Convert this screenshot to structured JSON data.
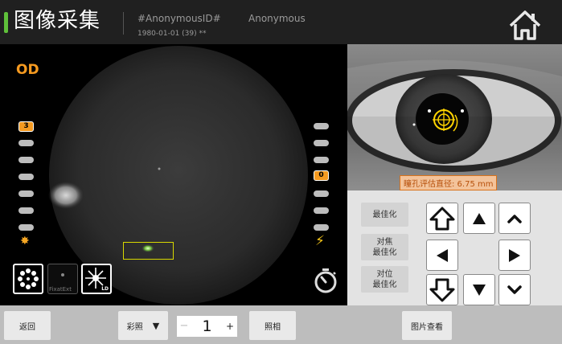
{
  "header": {
    "title": "图像采集",
    "patient_id": "#AnonymousID#",
    "patient_name": "Anonymous",
    "patient_dob": "1980-01-01 (39)   **",
    "home_icon": "home-icon"
  },
  "fundus": {
    "eye_label": "OD",
    "left_level": "3",
    "right_level": "0",
    "left_icon": "sun-icon",
    "right_icon": "flash-icon",
    "mode_buttons": [
      {
        "icon": "fixation-dots-icon"
      },
      {
        "icon": "fixation-ext-icon",
        "label": "FixatExt"
      },
      {
        "icon": "ld-light-icon",
        "label": "LD"
      }
    ],
    "timer_icon": "stopwatch-icon"
  },
  "pupil": {
    "label": "瞳孔评估直径: 6.75 mm"
  },
  "controls": {
    "optimize": "最佳化",
    "focus_line1": "对焦",
    "focus_line2": "最佳化",
    "align_line1": "对位",
    "align_line2": "最佳化"
  },
  "bottom": {
    "back": "返回",
    "color_mode": "彩照",
    "count_minus": "−",
    "count_value": "1",
    "count_plus": "+",
    "capture": "照相",
    "view_images": "图片查看"
  },
  "colors": {
    "accent_green": "#5fc03a",
    "level_orange": "#f59a20",
    "reticle_yellow": "#ffd400"
  }
}
